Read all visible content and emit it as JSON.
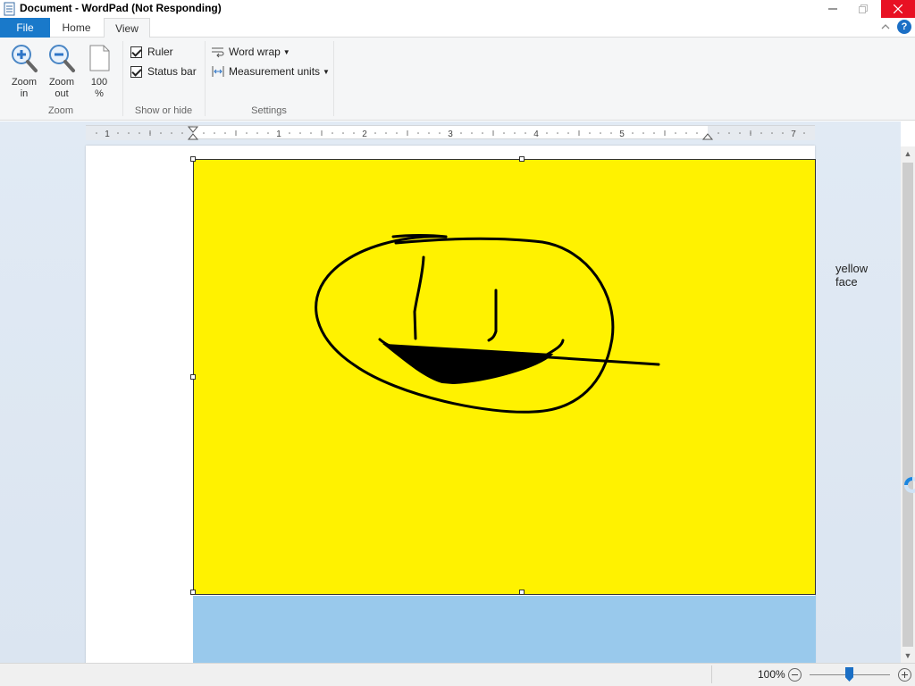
{
  "titlebar": {
    "title": "Document - WordPad (Not Responding)"
  },
  "tabs": {
    "file": "File",
    "home": "Home",
    "view": "View",
    "help_symbol": "?"
  },
  "ribbon": {
    "zoom_group": {
      "label": "Zoom",
      "zoom_in": [
        "Zoom",
        "in"
      ],
      "zoom_out": [
        "Zoom",
        "out"
      ],
      "hundred": [
        "100",
        "%"
      ]
    },
    "show_hide_group": {
      "label": "Show or hide",
      "ruler": "Ruler",
      "status_bar": "Status bar",
      "ruler_checked": true,
      "status_bar_checked": true
    },
    "settings_group": {
      "label": "Settings",
      "word_wrap": "Word wrap",
      "measurement_units": "Measurement units"
    }
  },
  "ruler": {
    "numbers": [
      "1",
      "1",
      "2",
      "3",
      "4",
      "5",
      "7"
    ]
  },
  "document": {
    "image_caption": "yellow face",
    "image_background": "#fff200",
    "below_image_color": "#99c9ec"
  },
  "statusbar": {
    "zoom_level": "100%"
  },
  "colors": {
    "file_tab": "#1979ca",
    "close_button": "#e81123",
    "accent": "#1b6fc5"
  }
}
